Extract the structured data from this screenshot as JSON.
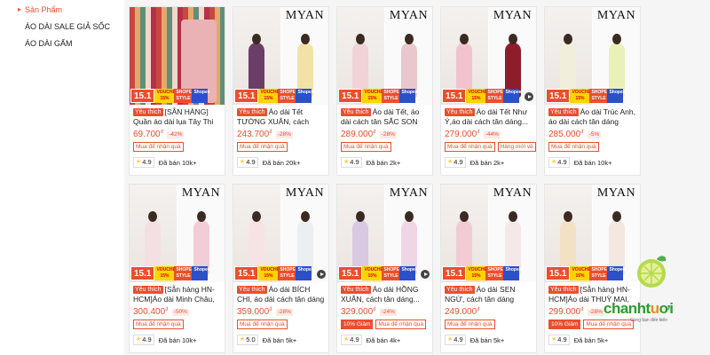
{
  "sidebar": {
    "items": [
      {
        "label": "Sản Phẩm",
        "active": true
      },
      {
        "label": "ÁO DÀI SALE GIẢ SỐC",
        "active": false
      },
      {
        "label": "ÁO DÀI GẤM",
        "active": false
      }
    ]
  },
  "promo": {
    "day": "15.1",
    "voucher": "VOUCHER 15%",
    "mall": "SHOPEE STYLE",
    "style": "Shopee"
  },
  "brand": "MYAN",
  "products": [
    {
      "fav": "Yêu thích",
      "title": "[SẴN HÀNG] Quần áo dài lụa Tây Thi ...",
      "price": "69.700",
      "currency": "₫",
      "discount": "-42%",
      "tags": [
        "Mua để nhận quà"
      ],
      "rating": "4.9",
      "sold": "Đã bán 10k+"
    },
    {
      "fav": "Yêu thích",
      "title": "Áo dài Tết TƯỜNG XUÂN, cách tân...",
      "price": "243.700",
      "currency": "₫",
      "discount": "-28%",
      "tags": [
        "Mua để nhận quà"
      ],
      "rating": "4.9",
      "sold": "Đã bán 20k+"
    },
    {
      "fav": "Yêu thích",
      "title": "Áo dài Tết, áo dài cách tân SẮC SON dáng...",
      "price": "289.000",
      "currency": "₫",
      "discount": "-28%",
      "tags": [
        "Mua để nhận quà"
      ],
      "rating": "4.9",
      "sold": "Đã bán 2k+"
    },
    {
      "fav": "Yêu thích",
      "title": "Áo dài Tết Như Ý,áo dài cách tân dáng...",
      "price": "279.000",
      "currency": "₫",
      "discount": "-44%",
      "tags": [
        "Mua để nhận quà",
        "Hàng mới về"
      ],
      "rating": "4.9",
      "sold": "Đã bán 2k+"
    },
    {
      "fav": "Yêu thích",
      "title": "Áo dài Trúc Anh, áo dài cách tân dáng suô...",
      "price": "285.000",
      "currency": "₫",
      "discount": "-5%",
      "tags": [
        "Mua để nhận quà"
      ],
      "rating": "4.9",
      "sold": "Đã bán 10k+"
    },
    {
      "fav": "Yêu thích",
      "title": "[Sẵn hàng HN-HCM]Áo dài Minh Châu, ...",
      "price": "300.400",
      "currency": "₫",
      "discount": "-50%",
      "tags": [
        "Mua để nhận quà"
      ],
      "rating": "4.9",
      "sold": "Đã bán 10k+"
    },
    {
      "fav": "Yêu thích",
      "title": "Áo dài BÍCH CHI, áo dài cách tân dáng suô...",
      "price": "359.000",
      "currency": "₫",
      "discount": "-28%",
      "tags": [
        "Mua để nhận quà"
      ],
      "rating": "5.0",
      "sold": "Đã bán 5k+"
    },
    {
      "fav": "Yêu thích",
      "title": "Áo dài HỒNG XUÂN, cách tân dáng...",
      "price": "329.000",
      "currency": "₫",
      "discount": "-24%",
      "tags": [
        "10% Giảm",
        "Mua để nhận quà"
      ],
      "rating": "4.9",
      "sold": "Đã bán 4k+"
    },
    {
      "fav": "Yêu thích",
      "title": "Áo dài SEN NGỪ, cách tân dáng suông 4 tà...",
      "price": "249.000",
      "currency": "₫",
      "discount": "",
      "tags": [
        "Mua để nhận quà"
      ],
      "rating": "4.9",
      "sold": "Đã bán 5k+"
    },
    {
      "fav": "Yêu thích",
      "title": "[Sẵn hàng HN-HCM]Áo dài THUỲ MAI, ...",
      "price": "299.000",
      "currency": "₫",
      "discount": "-28%",
      "tags": [
        "10% Giảm",
        "Mua để nhận quà"
      ],
      "rating": "4.9",
      "sold": "Đã bán 5k+"
    }
  ],
  "logo": {
    "word_a": "chanht",
    "word_b": "u",
    "word_c": "ơi",
    "tagline": "Cùng bạn đến kiến"
  },
  "colors": {
    "accent": "#ee4d2d",
    "logo_green": "#2a9d2e",
    "logo_orange": "#f08a1c"
  }
}
